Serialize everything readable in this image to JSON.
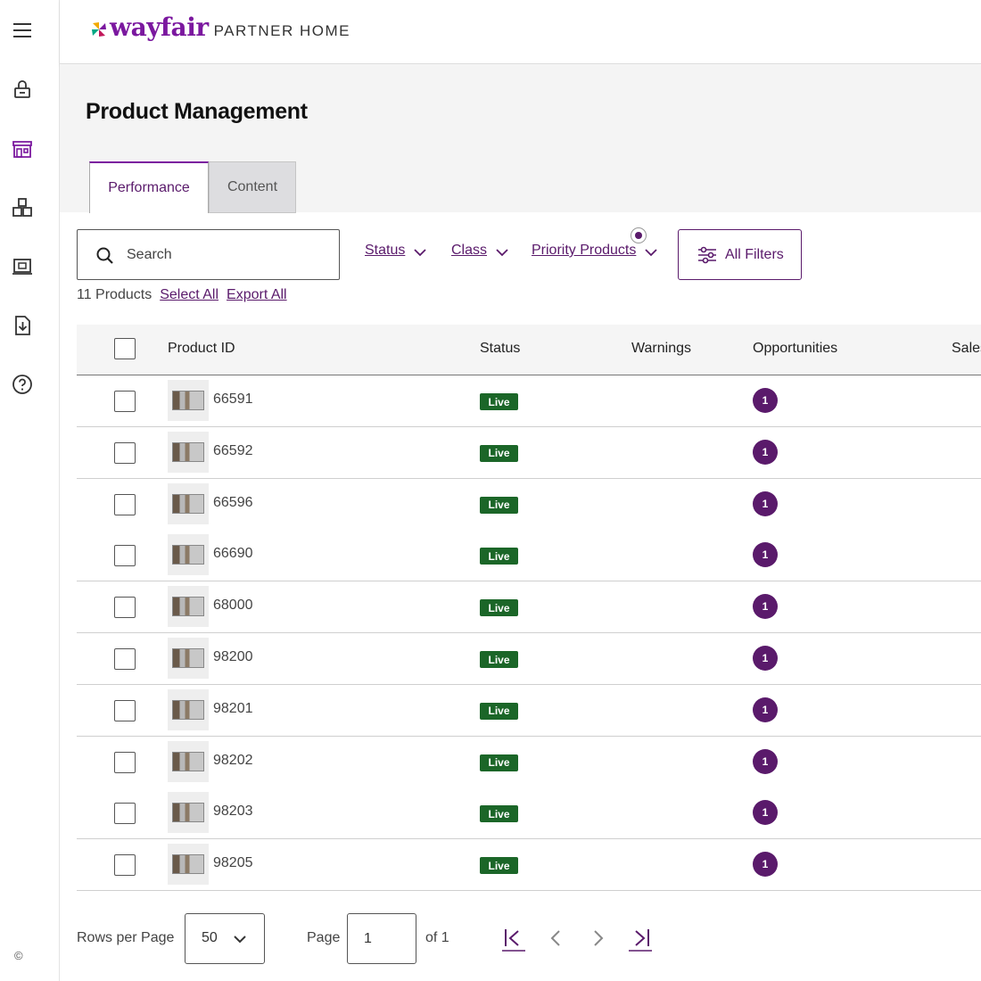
{
  "brand": {
    "name": "wayfair",
    "subtitle": "PARTNER HOME",
    "color": "#7b189f"
  },
  "sidebar": {
    "items": [
      {
        "icon": "menu-icon"
      },
      {
        "icon": "orders-lock-icon"
      },
      {
        "icon": "storefront-icon"
      },
      {
        "icon": "inventory-boxes-icon"
      },
      {
        "icon": "reports-screen-icon"
      },
      {
        "icon": "download-document-icon"
      },
      {
        "icon": "help-icon"
      }
    ],
    "footer": "©"
  },
  "page": {
    "title": "Product Management",
    "tabs": [
      {
        "label": "Performance",
        "active": true
      },
      {
        "label": "Content",
        "active": false
      }
    ]
  },
  "toolbar": {
    "search_placeholder": "Search",
    "filters": [
      {
        "label": "Status"
      },
      {
        "label": "Class"
      },
      {
        "label": "Priority Products"
      }
    ],
    "all_filters_label": "All Filters"
  },
  "summary": {
    "count_label": "11 Products",
    "select_all": "Select All",
    "export_all": "Export All"
  },
  "table": {
    "columns": [
      "Product ID",
      "Status",
      "Warnings",
      "Opportunities",
      "Sales"
    ],
    "rows": [
      {
        "id": "66591",
        "status": "Live",
        "opportunities": "1"
      },
      {
        "id": "66592",
        "status": "Live",
        "opportunities": "1"
      },
      {
        "id": "66596",
        "status": "Live",
        "opportunities": "1"
      },
      {
        "id": "66690",
        "status": "Live",
        "opportunities": "1"
      },
      {
        "id": "68000",
        "status": "Live",
        "opportunities": "1"
      },
      {
        "id": "98200",
        "status": "Live",
        "opportunities": "1"
      },
      {
        "id": "98201",
        "status": "Live",
        "opportunities": "1"
      },
      {
        "id": "98202",
        "status": "Live",
        "opportunities": "1"
      },
      {
        "id": "98203",
        "status": "Live",
        "opportunities": "1"
      },
      {
        "id": "98205",
        "status": "Live",
        "opportunities": "1"
      }
    ]
  },
  "pagination": {
    "rows_per_page_label": "Rows per Page",
    "rows_per_page_value": "50",
    "page_label": "Page",
    "page_value": "1",
    "of_label": "of 1"
  },
  "colors": {
    "accent": "#5a1a6b",
    "live": "#1b6628"
  }
}
